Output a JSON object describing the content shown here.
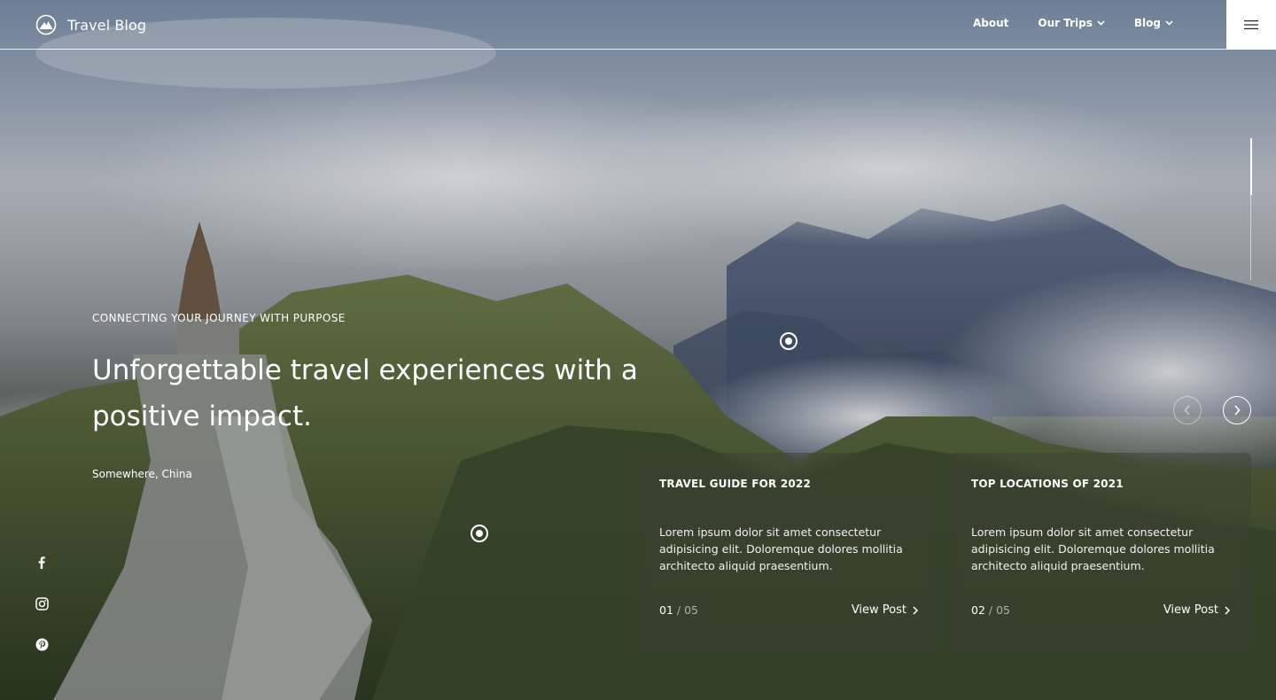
{
  "header": {
    "brand": "Travel Blog",
    "nav": [
      {
        "label": "About",
        "has_dropdown": false
      },
      {
        "label": "Our Trips",
        "has_dropdown": true
      },
      {
        "label": "Blog",
        "has_dropdown": true
      }
    ],
    "menu_icon": "hamburger-icon"
  },
  "hero": {
    "eyebrow": "CONNECTING YOUR JOURNEY WITH PURPOSE",
    "headline": "Unforgettable travel experiences with a positive impact.",
    "location": "Somewhere, China"
  },
  "socials": [
    {
      "name": "facebook",
      "icon": "facebook-icon"
    },
    {
      "name": "instagram",
      "icon": "instagram-icon"
    },
    {
      "name": "pinterest",
      "icon": "pinterest-icon"
    }
  ],
  "slider": {
    "prev_icon": "chevron-left-icon",
    "next_icon": "chevron-right-icon"
  },
  "cards": [
    {
      "title": "TRAVEL GUIDE FOR 2022",
      "text": "Lorem ipsum dolor sit amet consectetur adipisicing elit. Doloremque dolores mollitia architecto aliquid praesentium.",
      "index": "01",
      "total": "/ 05",
      "link": "View Post"
    },
    {
      "title": "TOP LOCATIONS OF 2021",
      "text": "Lorem ipsum dolor sit amet consectetur adipisicing elit. Doloremque dolores mollitia architecto aliquid praesentium.",
      "index": "02",
      "total": "/ 05",
      "link": "View Post"
    }
  ],
  "colors": {
    "text": "#ffffff",
    "menu_button_bg": "#ffffff",
    "card_bg": "rgba(60,64,52,0.42)"
  }
}
